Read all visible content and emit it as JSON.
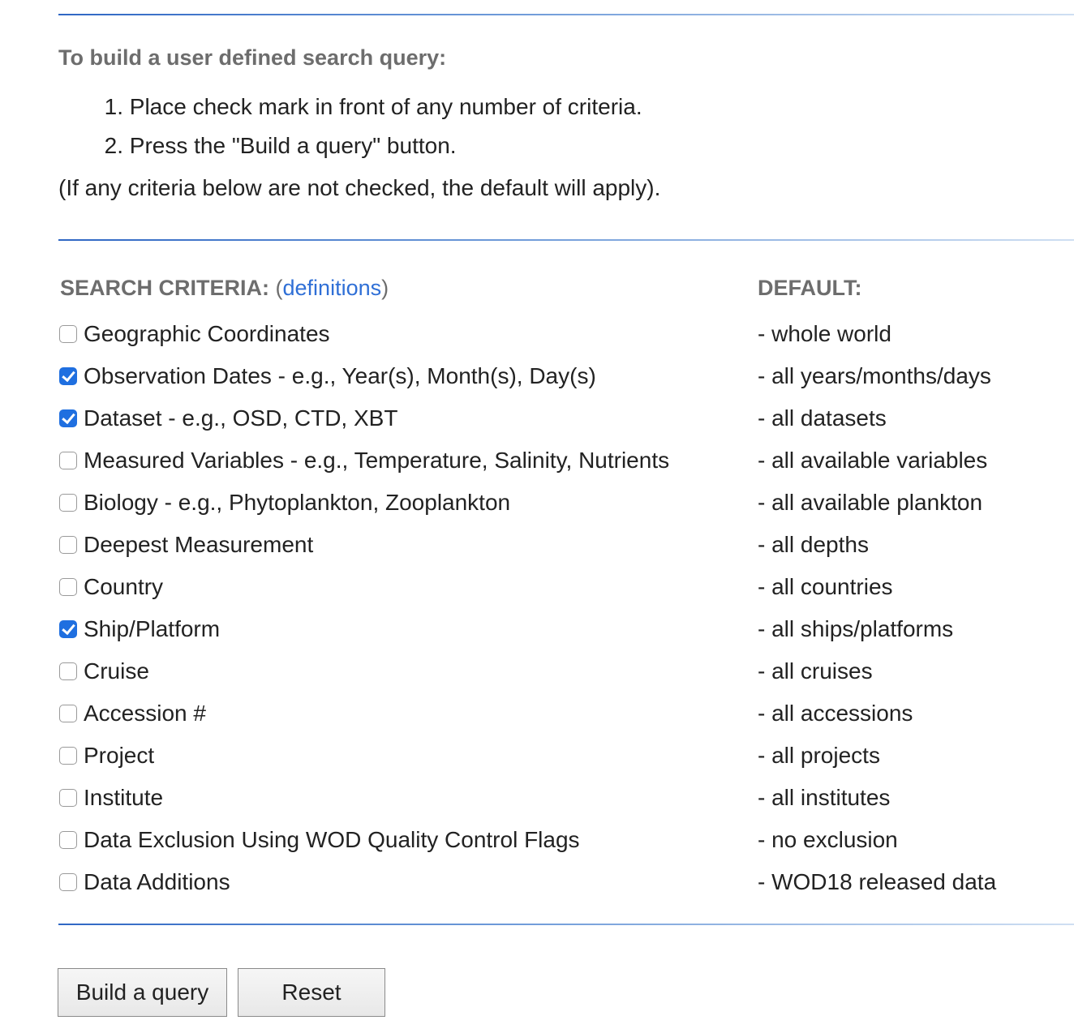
{
  "intro": {
    "title": "To build a user defined search query:",
    "steps": [
      {
        "num": "1.",
        "text": "Place check mark in front of any number of criteria."
      },
      {
        "num": "2.",
        "text": "Press the \"Build a query\" button."
      }
    ],
    "note": "(If any criteria below are not checked, the default will apply)."
  },
  "criteria_header": {
    "label": "SEARCH CRITERIA:",
    "open_paren": " (",
    "link": "definitions",
    "close_paren": ")",
    "default_label": "DEFAULT:"
  },
  "criteria": [
    {
      "label": "Geographic Coordinates",
      "default": "- whole world",
      "checked": false
    },
    {
      "label": "Observation Dates - e.g., Year(s), Month(s), Day(s)",
      "default": "- all years/months/days",
      "checked": true
    },
    {
      "label": "Dataset - e.g., OSD, CTD, XBT",
      "default": "- all datasets",
      "checked": true
    },
    {
      "label": "Measured Variables - e.g., Temperature, Salinity, Nutrients",
      "default": "- all available variables",
      "checked": false
    },
    {
      "label": "Biology - e.g., Phytoplankton, Zooplankton",
      "default": "- all available plankton",
      "checked": false
    },
    {
      "label": "Deepest Measurement",
      "default": "- all depths",
      "checked": false
    },
    {
      "label": "Country",
      "default": "- all countries",
      "checked": false
    },
    {
      "label": "Ship/Platform",
      "default": "- all ships/platforms",
      "checked": true
    },
    {
      "label": "Cruise",
      "default": "- all cruises",
      "checked": false
    },
    {
      "label": "Accession #",
      "default": "- all accessions",
      "checked": false
    },
    {
      "label": "Project",
      "default": "- all projects",
      "checked": false
    },
    {
      "label": "Institute",
      "default": "- all institutes",
      "checked": false
    },
    {
      "label": "Data Exclusion Using WOD Quality Control Flags",
      "default": "- no exclusion",
      "checked": false
    },
    {
      "label": "Data Additions",
      "default": "- WOD18 released data",
      "checked": false
    }
  ],
  "buttons": {
    "build": "Build a query",
    "reset": "Reset"
  },
  "colors": {
    "checkbox_checked": "#1f6fe0",
    "link": "#2f6fd6",
    "heading": "#6d6d6d",
    "rule": "#2f67c4"
  }
}
